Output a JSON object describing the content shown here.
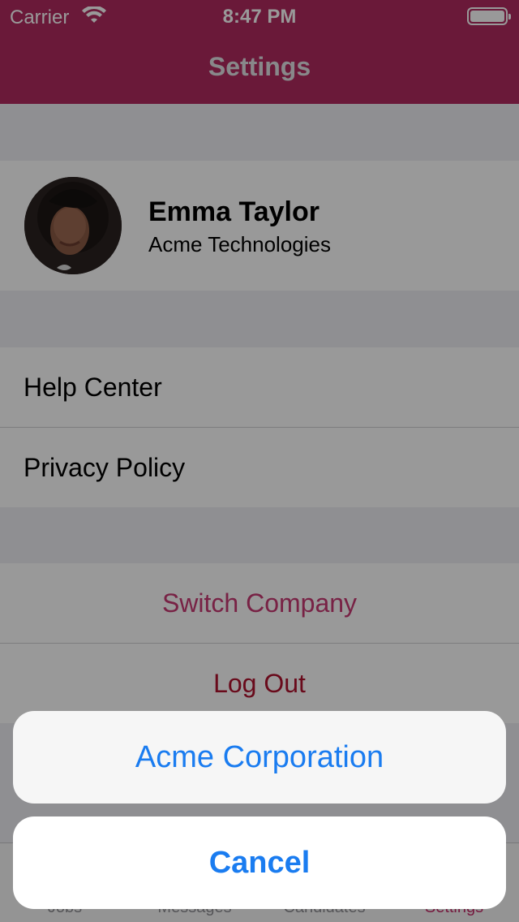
{
  "status_bar": {
    "carrier": "Carrier",
    "time": "8:47 PM"
  },
  "header": {
    "title": "Settings"
  },
  "profile": {
    "name": "Emma Taylor",
    "company": "Acme Technologies"
  },
  "menu": {
    "items": [
      {
        "label": "Help Center"
      },
      {
        "label": "Privacy Policy"
      }
    ]
  },
  "actions": {
    "switch_company": "Switch Company",
    "log_out": "Log Out"
  },
  "footer": {
    "text": ""
  },
  "tabbar": {
    "tabs": [
      {
        "label": "Jobs"
      },
      {
        "label": "Messages"
      },
      {
        "label": "Candidates"
      },
      {
        "label": "Settings"
      }
    ],
    "active_index": 3
  },
  "action_sheet": {
    "options": [
      {
        "label": "Acme Corporation"
      }
    ],
    "cancel_label": "Cancel"
  },
  "colors": {
    "brand": "#b12a5f",
    "accent_blue": "#1a7cf0",
    "switch_company": "#c83a73",
    "log_out": "#b0122e"
  }
}
